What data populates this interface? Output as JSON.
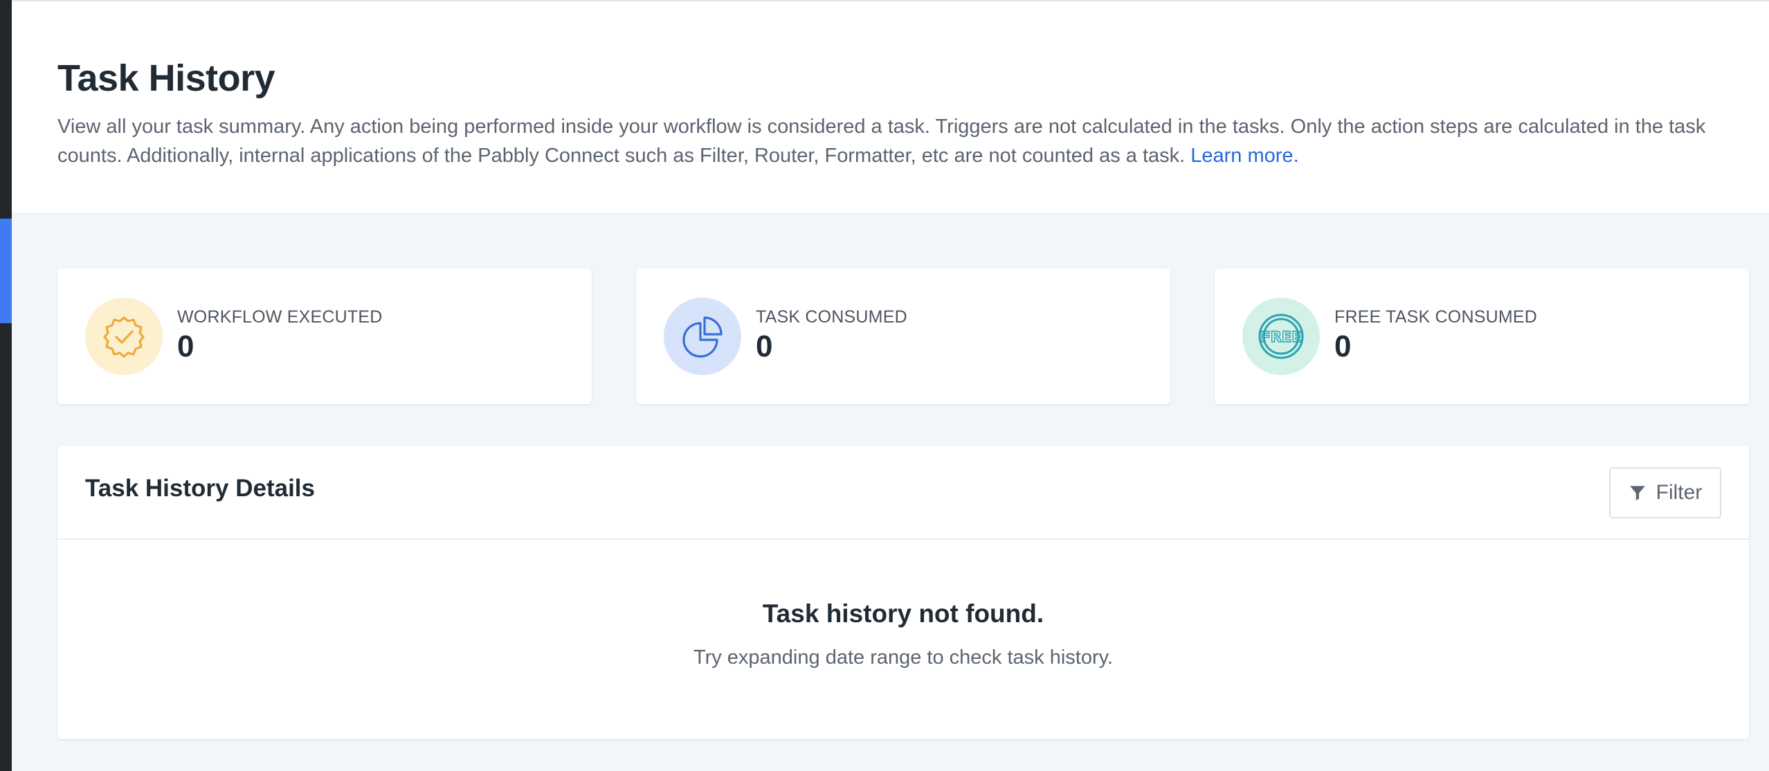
{
  "header": {
    "title": "Task History",
    "description": "View all your task summary. Any action being performed inside your workflow is considered a task. Triggers are not calculated in the tasks. Only the action steps are calculated in the task counts. Additionally, internal applications of the Pabbly Connect such as Filter, Router, Formatter, etc are not counted as a task.",
    "learn_more": "Learn more."
  },
  "stats": [
    {
      "label": "WORKFLOW EXECUTED",
      "value": "0",
      "icon": "badge-check-icon",
      "icon_bg": "#fdf0cf",
      "icon_color": "#f0a93a"
    },
    {
      "label": "TASK CONSUMED",
      "value": "0",
      "icon": "pie-chart-icon",
      "icon_bg": "#d7e3fb",
      "icon_color": "#3a6ed8"
    },
    {
      "label": "FREE TASK CONSUMED",
      "value": "0",
      "icon": "free-stamp-icon",
      "icon_bg": "#d3f1e6",
      "icon_color": "#2aa4b2"
    }
  ],
  "details": {
    "title": "Task History Details",
    "filter_label": "Filter",
    "empty_title": "Task history not found.",
    "empty_subtitle": "Try expanding date range to check task history."
  },
  "colors": {
    "accent": "#2468e0",
    "sidebar": "#23262b",
    "sidebar_active": "#3f7cf2"
  }
}
